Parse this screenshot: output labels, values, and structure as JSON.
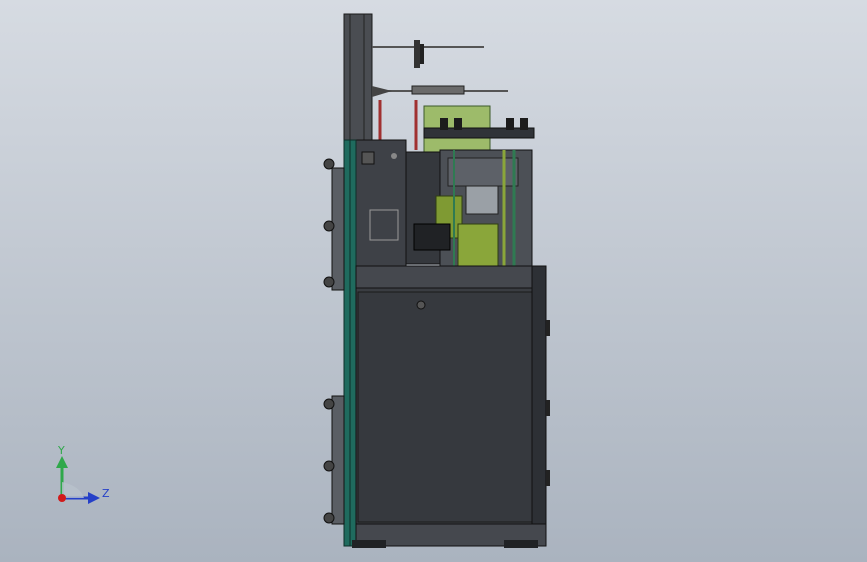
{
  "viewport": {
    "background_top": "#d6dbe2",
    "background_bottom": "#aab3bf"
  },
  "axis_triad": {
    "y_label": "Y",
    "z_label": "Z",
    "y_color": "#2fa84a",
    "z_color": "#2540c8",
    "x_color": "#d11a1a"
  },
  "model": {
    "body_color": "#3c3f44",
    "frame_color": "#1f6b5e",
    "accent_green": "#8aa63a",
    "accent_red": "#b33a3a"
  }
}
